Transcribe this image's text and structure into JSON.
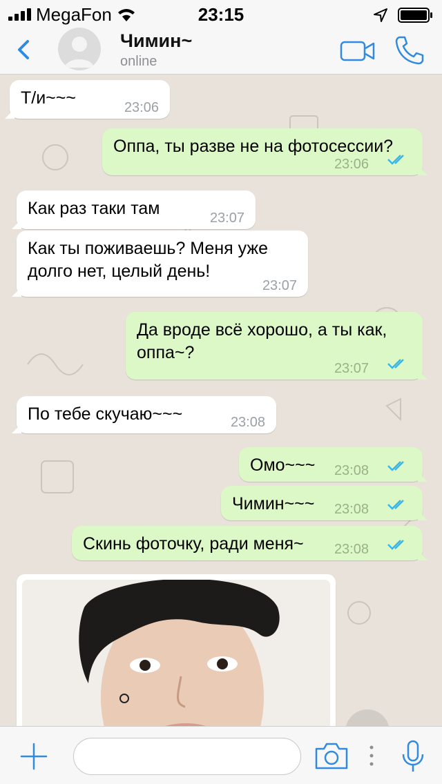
{
  "status_bar": {
    "carrier": "MegaFon",
    "time": "23:15"
  },
  "header": {
    "contact_name": "Чимин~",
    "contact_status": "online"
  },
  "messages": [
    {
      "direction": "in",
      "text": "Т/и~~~",
      "time": "23:06"
    },
    {
      "direction": "out",
      "text": "Оппа, ты разве не на фотосессии?",
      "time": "23:06",
      "read": true
    },
    {
      "direction": "in",
      "text": "Как раз таки там",
      "time": "23:07"
    },
    {
      "direction": "in",
      "text_lines": [
        "Как ты поживаешь? Меня уже",
        "долго нет, целый день!"
      ],
      "time": "23:07"
    },
    {
      "direction": "out",
      "text_lines": [
        "Да вроде всё хорошо, а ты как,",
        "оппа~?"
      ],
      "time": "23:07",
      "read": true
    },
    {
      "direction": "in",
      "text": "По тебе скучаю~~~",
      "time": "23:08"
    },
    {
      "direction": "out",
      "text": "Омо~~~",
      "time": "23:08",
      "read": true
    },
    {
      "direction": "out",
      "text": "Чимин~~~",
      "time": "23:08",
      "read": true
    },
    {
      "direction": "out",
      "text": "Скинь фоточку, ради меня~",
      "time": "23:08",
      "read": true
    }
  ],
  "icons": {
    "back": "chevron-left-icon",
    "video": "video-camera-icon",
    "call": "phone-icon",
    "attach": "plus-icon",
    "camera": "camera-icon",
    "more": "more-dots-icon",
    "mic": "microphone-icon",
    "read": "double-check-icon"
  },
  "composer": {
    "value": "",
    "placeholder": ""
  },
  "colors": {
    "accent": "#2f8ae0",
    "incoming_bubble": "#ffffff",
    "outgoing_bubble": "#dcf8c6",
    "read_ticks": "#34b7f1",
    "chat_background": "#e8e2da"
  }
}
